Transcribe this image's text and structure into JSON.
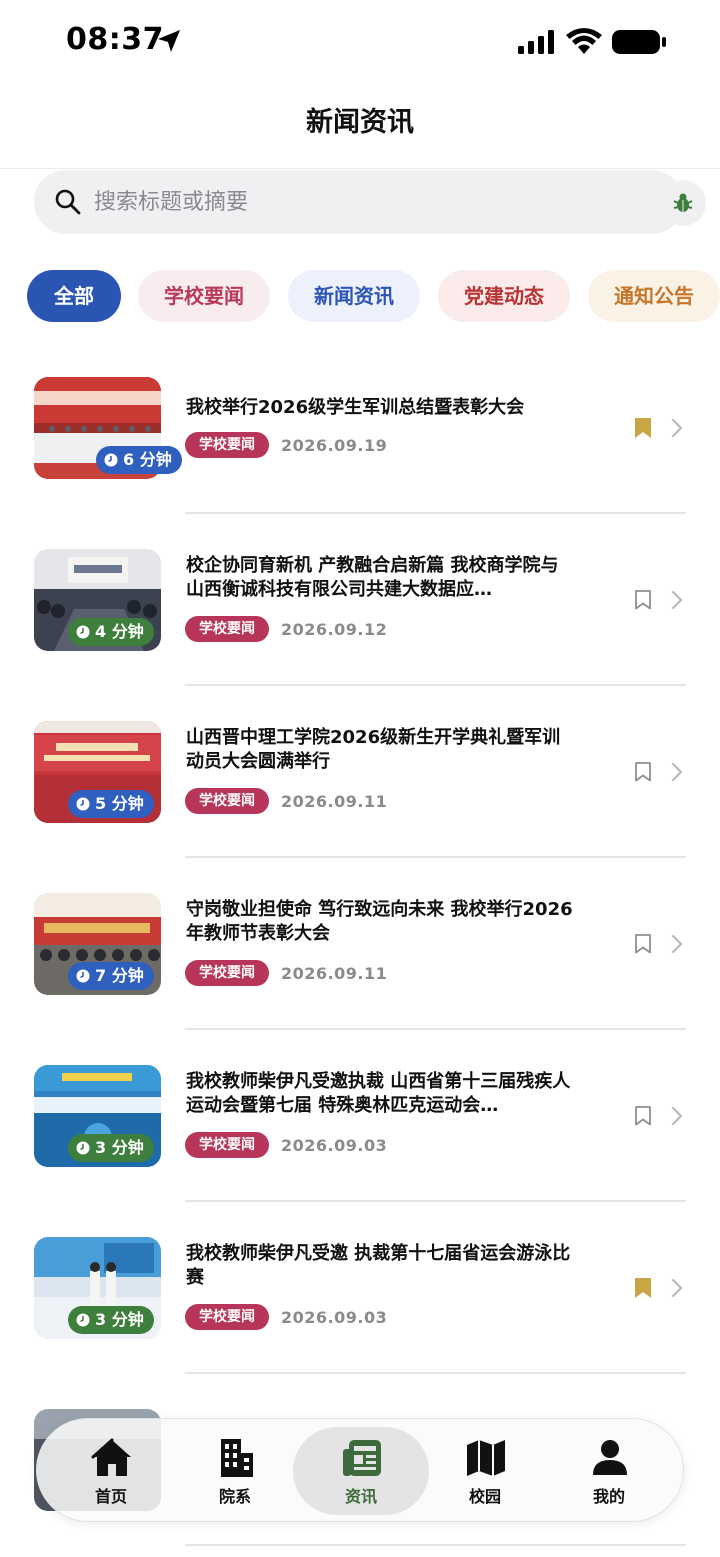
{
  "status_bar": {
    "time": "08:37"
  },
  "header": {
    "title": "新闻资讯"
  },
  "search": {
    "placeholder": "搜索标题或摘要"
  },
  "tabs": [
    {
      "label": "全部",
      "active": true
    },
    {
      "label": "学校要闻"
    },
    {
      "label": "新闻资讯"
    },
    {
      "label": "党建动态"
    },
    {
      "label": "通知公告"
    }
  ],
  "news": [
    {
      "title": "我校举行2026级学生军训总结暨表彰大会",
      "category": "学校要闻",
      "date": "2026.09.19",
      "read_time": "6 分钟",
      "bookmarked": true
    },
    {
      "title": "校企协同育新机 产教融合启新篇 我校商学院与山西衡诚科技有限公司共建大数据应…",
      "category": "学校要闻",
      "date": "2026.09.12",
      "read_time": "4 分钟",
      "bookmarked": false
    },
    {
      "title": "山西晋中理工学院2026级新生开学典礼暨军训动员大会圆满举行",
      "category": "学校要闻",
      "date": "2026.09.11",
      "read_time": "5 分钟",
      "bookmarked": false
    },
    {
      "title": "守岗敬业担使命 笃行致远向未来 我校举行2026年教师节表彰大会",
      "category": "学校要闻",
      "date": "2026.09.11",
      "read_time": "7 分钟",
      "bookmarked": false
    },
    {
      "title": "我校教师柴伊凡受邀执裁 山西省第十三届残疾人运动会暨第七届 特殊奥林匹克运动会…",
      "category": "学校要闻",
      "date": "2026.09.03",
      "read_time": "3 分钟",
      "bookmarked": false
    },
    {
      "title": "我校教师柴伊凡受邀 执裁第十七届省运会游泳比赛",
      "category": "学校要闻",
      "date": "2026.09.03",
      "read_time": "3 分钟",
      "bookmarked": true
    }
  ],
  "colors": {
    "accent_blue": "#2b55b3",
    "badge_red": "#b63558",
    "bookmark_gold": "#c9a544",
    "duration_blue": "#2f5fbf",
    "duration_green": "#3f7f3d",
    "nav_active_green": "#3e6b3c"
  },
  "bottom_nav": [
    {
      "label": "首页",
      "icon": "home-icon"
    },
    {
      "label": "院系",
      "icon": "building-icon"
    },
    {
      "label": "资讯",
      "icon": "news-icon",
      "active": true
    },
    {
      "label": "校园",
      "icon": "map-icon"
    },
    {
      "label": "我的",
      "icon": "person-icon"
    }
  ]
}
